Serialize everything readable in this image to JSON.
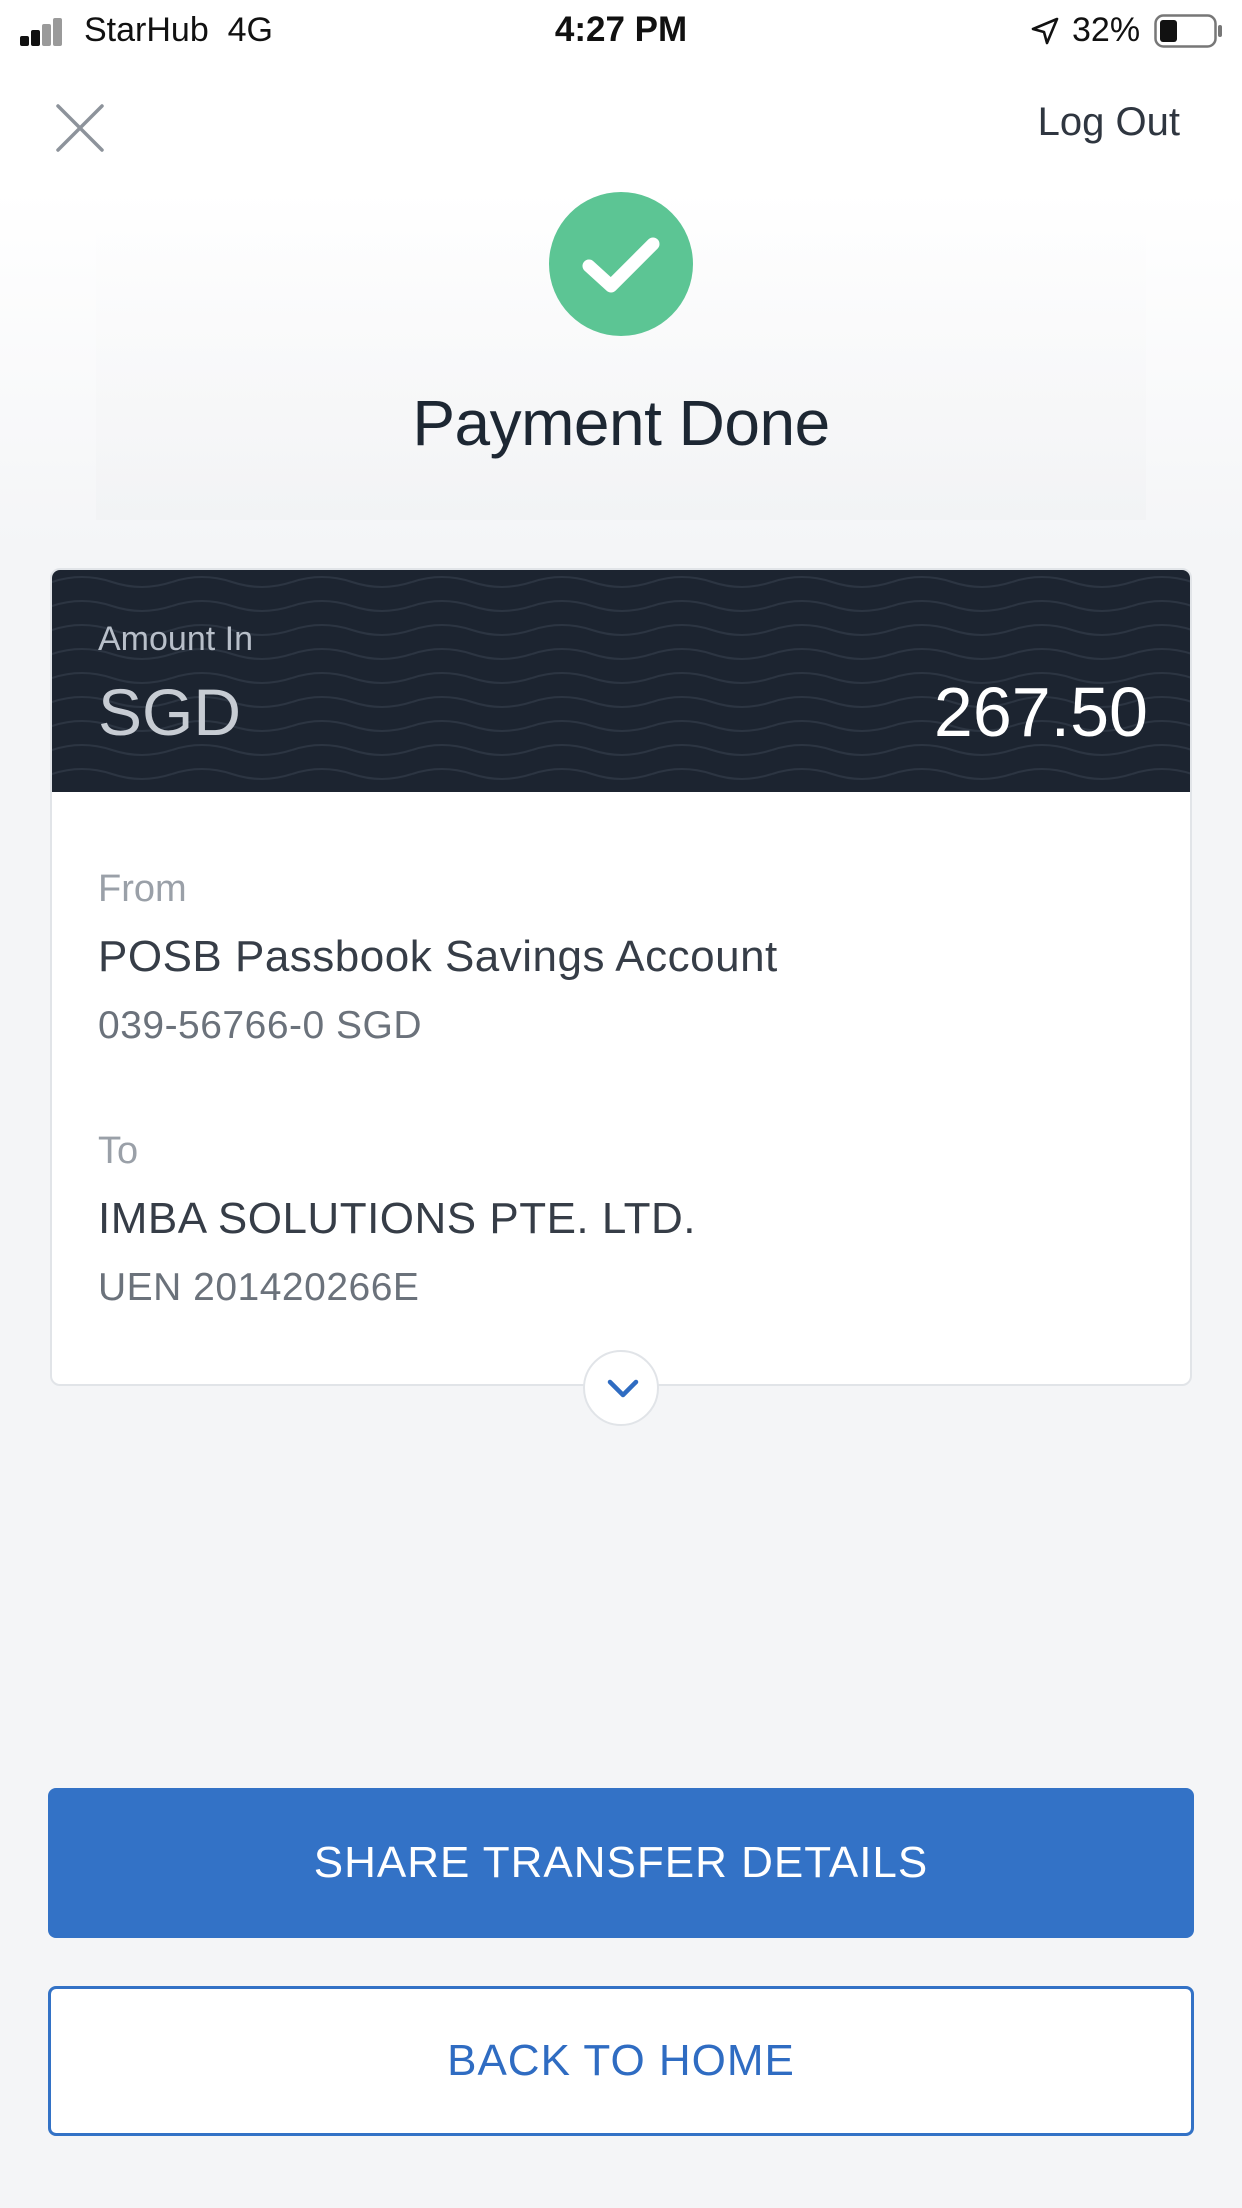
{
  "status_bar": {
    "carrier": "StarHub",
    "network": "4G",
    "time": "4:27 PM",
    "battery_percent": "32%",
    "icons": [
      "signal-icon",
      "location-arrow-icon",
      "battery-icon"
    ]
  },
  "header": {
    "close_icon": "close-icon",
    "logout_label": "Log Out"
  },
  "hero": {
    "success_icon": "checkmark-icon",
    "title": "Payment Done"
  },
  "transfer": {
    "amount_label": "Amount In",
    "currency": "SGD",
    "amount": "267.50",
    "from_label": "From",
    "from_account_name": "POSB Passbook Savings Account",
    "from_account_number": "039-56766-0 SGD",
    "to_label": "To",
    "to_name": "IMBA SOLUTIONS PTE. LTD.",
    "to_uen": "UEN 201420266E",
    "expand_icon": "chevron-down-icon"
  },
  "actions": {
    "share_label": "SHARE TRANSFER DETAILS",
    "home_label": "BACK TO HOME"
  },
  "colors": {
    "accent": "#3372c6",
    "success": "#5cc594",
    "amount_band": "#1c2430",
    "background": "#f4f5f7"
  }
}
